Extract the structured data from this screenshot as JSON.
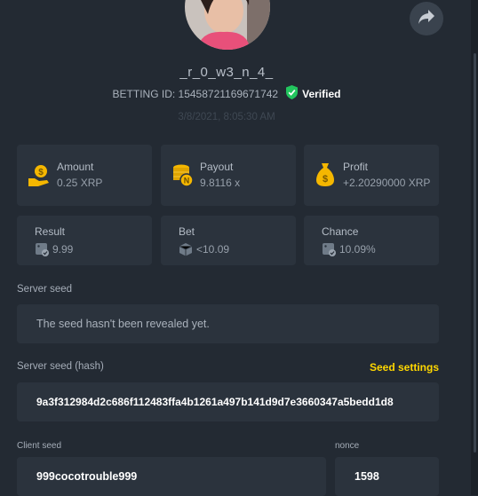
{
  "user": {
    "username": "_r_0_w3_n_4_",
    "betting_id": "BETTING ID: 15458721169671742",
    "verified_label": "Verified",
    "date": "3/8/2021, 8:05:30 AM"
  },
  "icons": {
    "share": "share-icon",
    "verified": "shield-check-icon",
    "amount": "hand-coin-icon",
    "payout": "coin-stack-icon",
    "profit": "money-bag-icon",
    "result": "dice-check-icon",
    "bet": "dice-icon",
    "chance": "dice-check-icon"
  },
  "stats": {
    "amount": {
      "label": "Amount",
      "value": "0.25 XRP"
    },
    "payout": {
      "label": "Payout",
      "value": "9.8116 x"
    },
    "profit": {
      "label": "Profit",
      "value": "+2.20290000 XRP"
    },
    "result": {
      "label": "Result",
      "value": "9.99"
    },
    "bet": {
      "label": "Bet",
      "value": "<10.09"
    },
    "chance": {
      "label": "Chance",
      "value": "10.09%"
    }
  },
  "seeds": {
    "server_seed_label": "Server seed",
    "server_seed_value": "The seed hasn't been revealed yet.",
    "server_hash_label": "Server seed (hash)",
    "seed_settings_link": "Seed settings",
    "server_hash_value": "9a3f312984d2c686f112483ffa4b1261a497b141d9d7e3660347a5bedd1d8",
    "client_seed_label": "Client seed",
    "client_seed_value": "999cocotrouble999",
    "nonce_label": "nonce",
    "nonce_value": "1598"
  },
  "colors": {
    "background": "#232a33",
    "card": "#2b333d",
    "accent_yellow": "#ffd700",
    "verified_green": "#22c55e"
  }
}
